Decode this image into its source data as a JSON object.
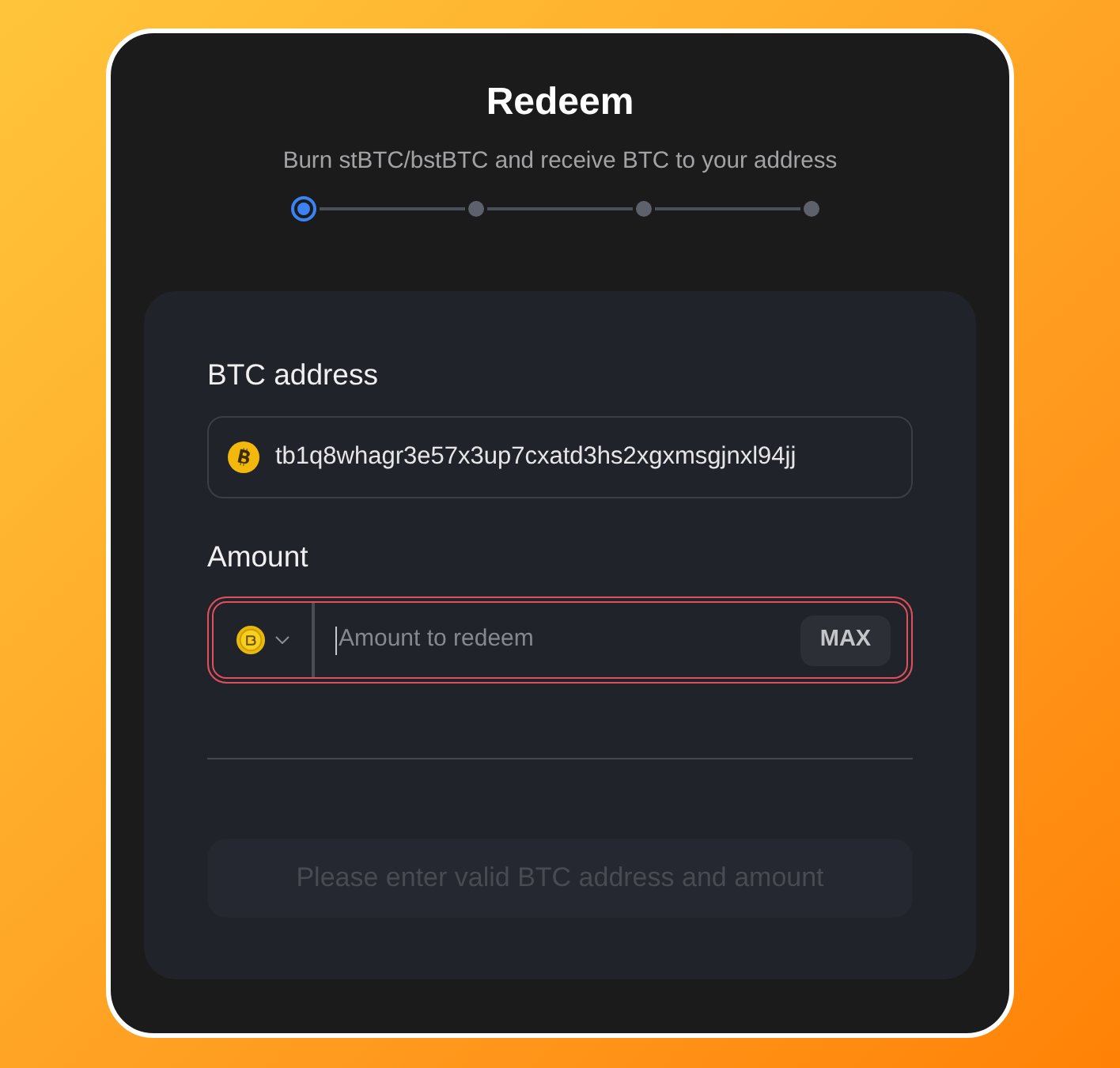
{
  "dialog": {
    "title": "Redeem",
    "subtitle": "Burn stBTC/bstBTC and receive BTC to your address"
  },
  "steps": [
    {
      "selected": true
    },
    {
      "selected": false
    },
    {
      "selected": false
    },
    {
      "selected": false
    }
  ],
  "address": {
    "label": "BTC address",
    "value": "tb1q8whagr3e57x3up7cxatd3hs2xgxmsgjnxl94jj"
  },
  "amount": {
    "label": "Amount",
    "placeholder": "Amount to redeem",
    "invalid": true,
    "focused": true,
    "max_button": "MAX"
  },
  "submit": {
    "label": "Please enter valid BTC address and amount",
    "disabled": true
  }
}
